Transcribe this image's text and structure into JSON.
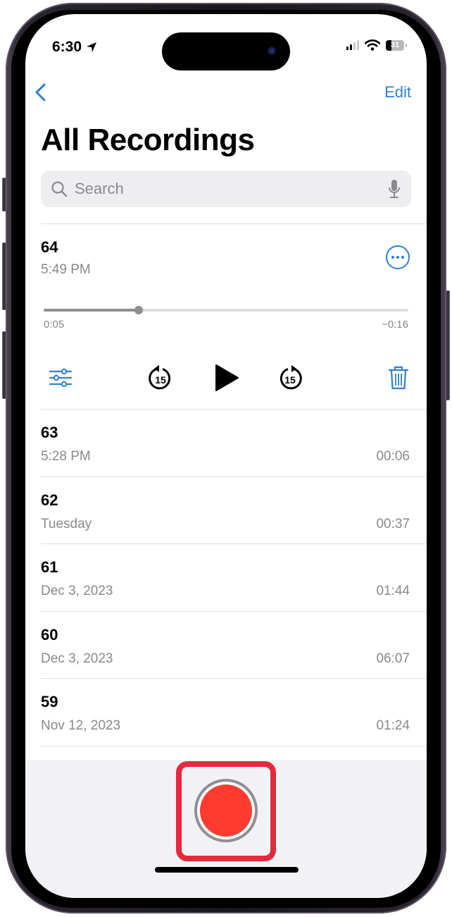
{
  "status_bar": {
    "time": "6:30",
    "battery": "31",
    "battery_fraction": 0.31,
    "location_icon": "location-arrow-icon",
    "signal_icon": "cellular-signal-icon",
    "wifi_icon": "wifi-icon"
  },
  "nav": {
    "back_icon": "chevron-left-icon",
    "edit_label": "Edit"
  },
  "title": "All Recordings",
  "search": {
    "placeholder": "Search",
    "search_icon": "magnifier-icon",
    "mic_icon": "microphone-icon"
  },
  "expanded_recording": {
    "name": "64",
    "subtitle": "5:49 PM",
    "elapsed": "0:05",
    "remaining": "−0:16",
    "progress_fraction": 0.26,
    "more_icon": "ellipsis-circle-icon",
    "controls": {
      "options_icon": "sliders-icon",
      "skip_back_icon": "skip-back-15-icon",
      "skip_back_label": "15",
      "play_icon": "play-icon",
      "skip_forward_icon": "skip-forward-15-icon",
      "skip_forward_label": "15",
      "delete_icon": "trash-icon"
    }
  },
  "recordings": [
    {
      "name": "63",
      "date": "5:28 PM",
      "duration": "00:06"
    },
    {
      "name": "62",
      "date": "Tuesday",
      "duration": "00:37"
    },
    {
      "name": "61",
      "date": "Dec 3, 2023",
      "duration": "01:44"
    },
    {
      "name": "60",
      "date": "Dec 3, 2023",
      "duration": "06:07"
    },
    {
      "name": "59",
      "date": "Nov 12, 2023",
      "duration": "01:24"
    }
  ],
  "record_button": {
    "icon": "record-icon",
    "color": "#ff3b30",
    "highlight_color": "#e8283c"
  },
  "colors": {
    "accent": "#2f7fd6",
    "secondary_text": "#8a8a8e"
  }
}
